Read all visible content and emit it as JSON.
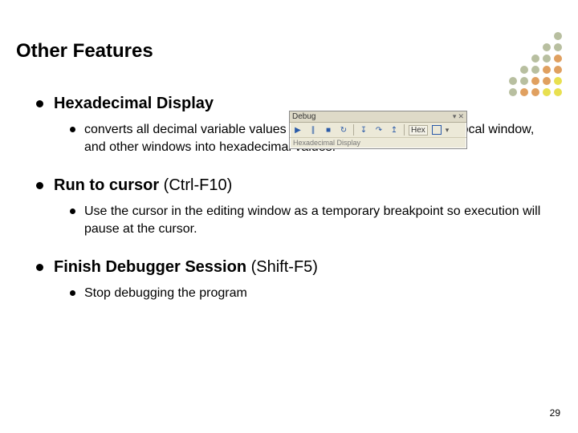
{
  "title": "Other Features",
  "sections": [
    {
      "heading_bold": "Hexadecimal Display",
      "heading_rest": "",
      "sub": [
        " converts all decimal variable values that are in the watch window, local window, and other windows into hexadecimal values."
      ]
    },
    {
      "heading_bold": "Run to cursor",
      "heading_rest": " (Ctrl-F10)",
      "sub": [
        "Use the cursor in the editing window as a temporary breakpoint so execution will pause at the cursor."
      ]
    },
    {
      "heading_bold": "Finish Debugger Session",
      "heading_rest": " (Shift-F5)",
      "sub": [
        "Stop debugging the program"
      ]
    }
  ],
  "toolbar": {
    "title": "Debug",
    "hex_label": "Hex",
    "tooltip": "Hexadecimal Display"
  },
  "page_number": "29"
}
